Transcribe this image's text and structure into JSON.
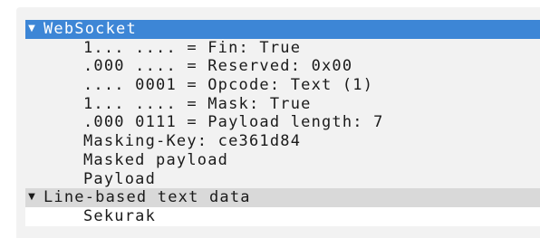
{
  "tree": {
    "websocket": {
      "label": "WebSocket",
      "toggle": "▼",
      "children": [
        "1... .... = Fin: True",
        ".000 .... = Reserved: 0x00",
        ".... 0001 = Opcode: Text (1)",
        "1... .... = Mask: True",
        ".000 0111 = Payload length: 7",
        "Masking-Key: ce361d84",
        "Masked payload",
        "Payload"
      ]
    },
    "line_based": {
      "label": "Line-based text data",
      "toggle": "▼",
      "children": [
        "Sekurak"
      ]
    }
  },
  "colors": {
    "selected_bg": "#3d86d6",
    "panel_bg": "#f2f2f2",
    "grey_row_bg": "#d9d9d9"
  }
}
